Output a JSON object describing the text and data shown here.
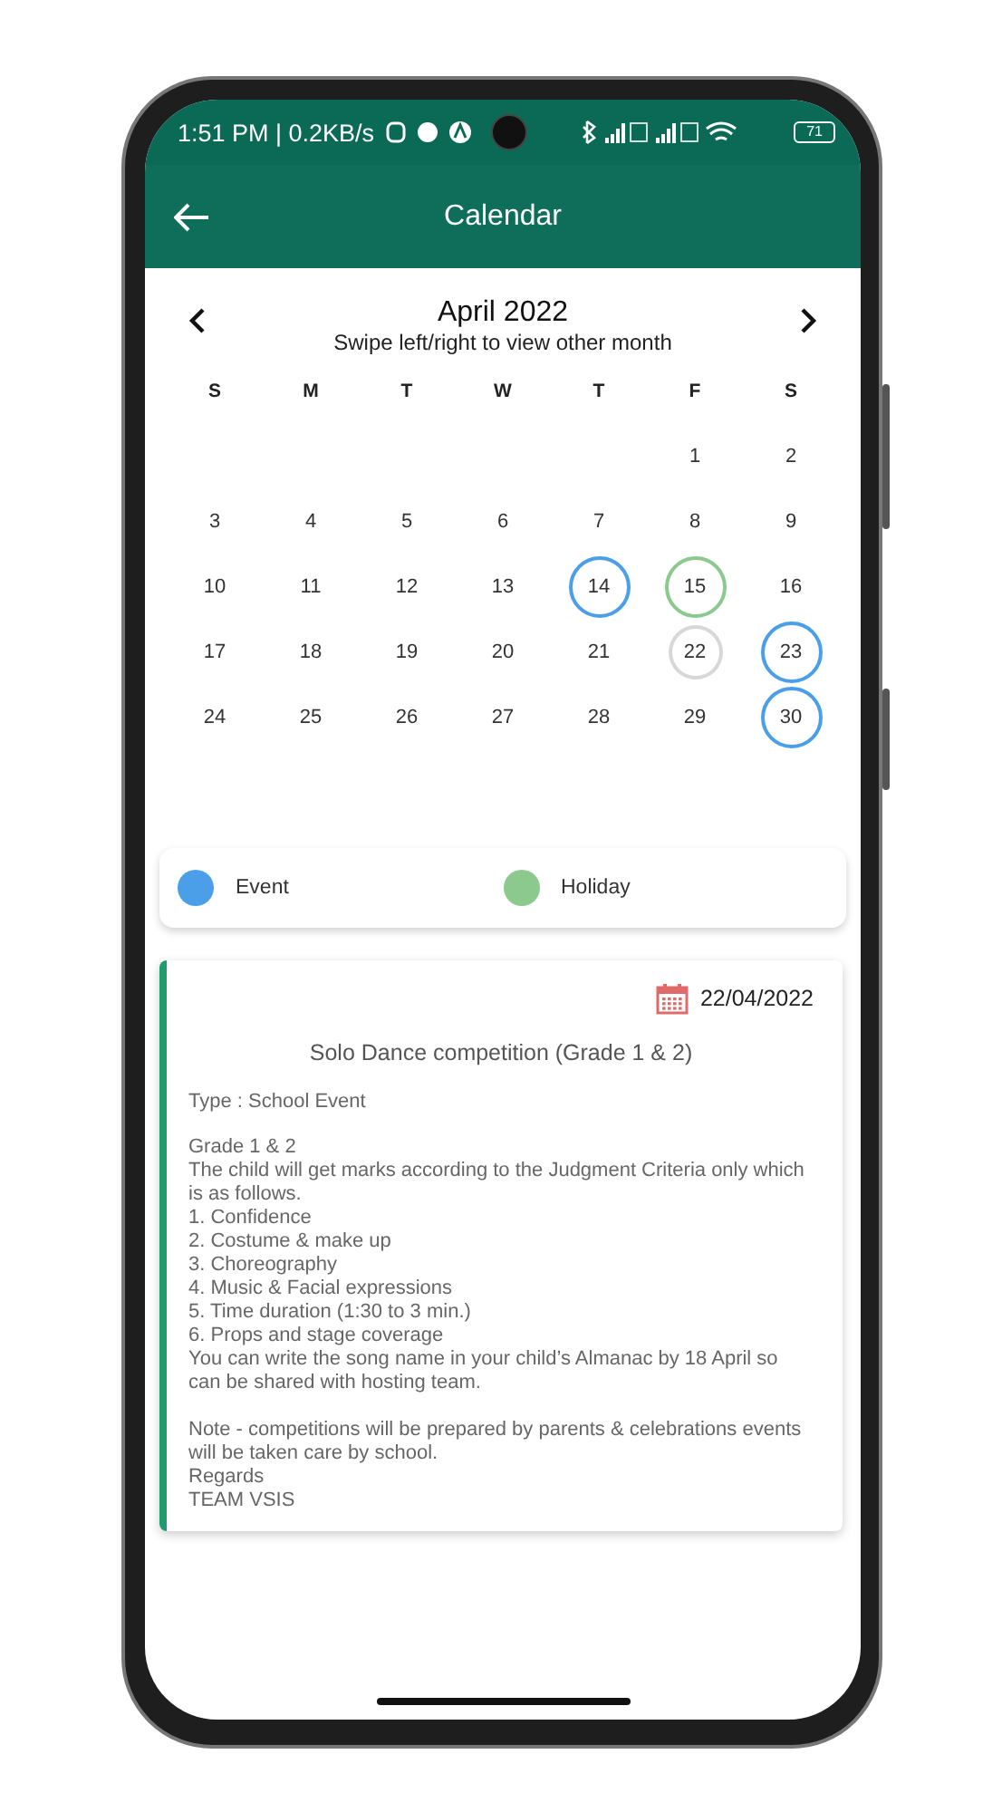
{
  "status_bar": {
    "time_speed": "1:51 PM | 0.2KB/s",
    "battery": "71"
  },
  "app_bar": {
    "title": "Calendar"
  },
  "calendar": {
    "month": "April 2022",
    "hint": "Swipe left/right to view other month",
    "weekdays": [
      "S",
      "M",
      "T",
      "W",
      "T",
      "F",
      "S"
    ],
    "weeks": [
      [
        {
          "day": "1",
          "selected": false
        },
        {
          "day": "2",
          "selected": false
        }
      ],
      [
        {
          "day": "3",
          "selected": false
        },
        {
          "day": "4",
          "selected": false
        },
        {
          "day": "5",
          "selected": false
        },
        {
          "day": "6",
          "selected": false
        },
        {
          "day": "7",
          "selected": false
        },
        {
          "day": "8",
          "selected": false
        },
        {
          "day": "9",
          "selected": false
        }
      ],
      [
        {
          "day": "10",
          "selected": false
        },
        {
          "day": "11",
          "selected": false
        },
        {
          "day": "12",
          "selected": false
        },
        {
          "day": "13",
          "selected": false
        },
        {
          "day": "14",
          "selected": false,
          "color": "#4a9fe8"
        },
        {
          "day": "15",
          "selected": false,
          "color": "#8cc98e"
        },
        {
          "day": "16",
          "selected": false
        }
      ],
      [
        {
          "day": "17",
          "selected": false
        },
        {
          "day": "18",
          "selected": false
        },
        {
          "day": "19",
          "selected": false
        },
        {
          "day": "20",
          "selected": false
        },
        {
          "day": "21",
          "selected": false
        },
        {
          "day": "22",
          "selected": true
        },
        {
          "day": "23",
          "selected": false,
          "color": "#4a9fe8"
        }
      ],
      [
        {
          "day": "24",
          "selected": false
        },
        {
          "day": "25",
          "selected": false
        },
        {
          "day": "26",
          "selected": false
        },
        {
          "day": "27",
          "selected": false
        },
        {
          "day": "28",
          "selected": false
        },
        {
          "day": "29",
          "selected": false
        },
        {
          "day": "30",
          "selected": false,
          "color": "#4a9fe8"
        }
      ]
    ]
  },
  "legend": [
    {
      "label": "Event",
      "color": "#4a9fe8"
    },
    {
      "label": "Holiday",
      "color": "#8cc98e"
    }
  ],
  "event": {
    "date": "22/04/2022",
    "title": "Solo Dance competition (Grade 1 & 2)",
    "type": "Type :  School Event",
    "lines": [
      "Grade 1 & 2",
      "The child will get marks according to the Judgment Criteria only which is as follows.",
      "1. Confidence",
      "2. Costume & make up",
      "3. Choreography",
      "4. Music & Facial expressions",
      "5. Time duration (1:30 to 3 min.)",
      "6. Props and stage coverage",
      "You can write the song name in your child’s Almanac by 18 April so can be shared with hosting team."
    ],
    "note_lines": [
      "Note - competitions will be prepared by parents & celebrations events will be taken care by school.",
      "Regards",
      "TEAM VSIS"
    ]
  }
}
